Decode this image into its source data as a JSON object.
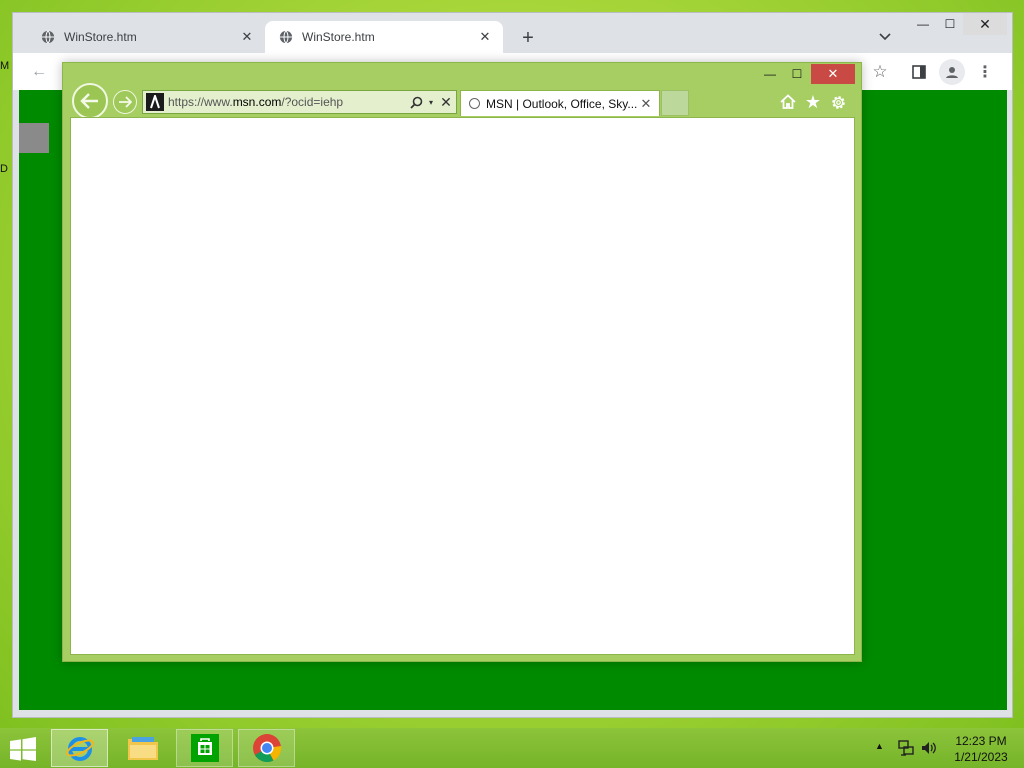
{
  "desktop": {
    "edge_chars": [
      "M",
      "D"
    ]
  },
  "chrome": {
    "tabs": [
      {
        "title": "WinStore.htm",
        "active": false
      },
      {
        "title": "WinStore.htm",
        "active": true
      }
    ],
    "new_tab_label": "+",
    "tab_search_label": "⌄",
    "window_controls": {
      "minimize": "—",
      "maximize": "☐",
      "close": "✕"
    },
    "toolbar": {
      "back": "←",
      "star": "☆",
      "menu": "⋮"
    },
    "content_bg": "#008a00"
  },
  "ie": {
    "window_controls": {
      "minimize": "—",
      "maximize": "☐",
      "close": "✕"
    },
    "address": {
      "url_prefix": "https://www.",
      "url_domain": "msn.com",
      "url_suffix": "/?ocid=iehp",
      "dropdown": "▾",
      "stop": "✕"
    },
    "tab": {
      "title": "MSN | Outlook, Office, Sky...",
      "close": "✕"
    },
    "tools": {
      "favorites": "★"
    },
    "accent": "#a6ce62"
  },
  "taskbar": {
    "apps": [
      "internet-explorer",
      "file-explorer",
      "store",
      "chrome"
    ],
    "tray_arrow": "▲",
    "clock": {
      "time": "12:23 PM",
      "date": "1/21/2023"
    }
  }
}
